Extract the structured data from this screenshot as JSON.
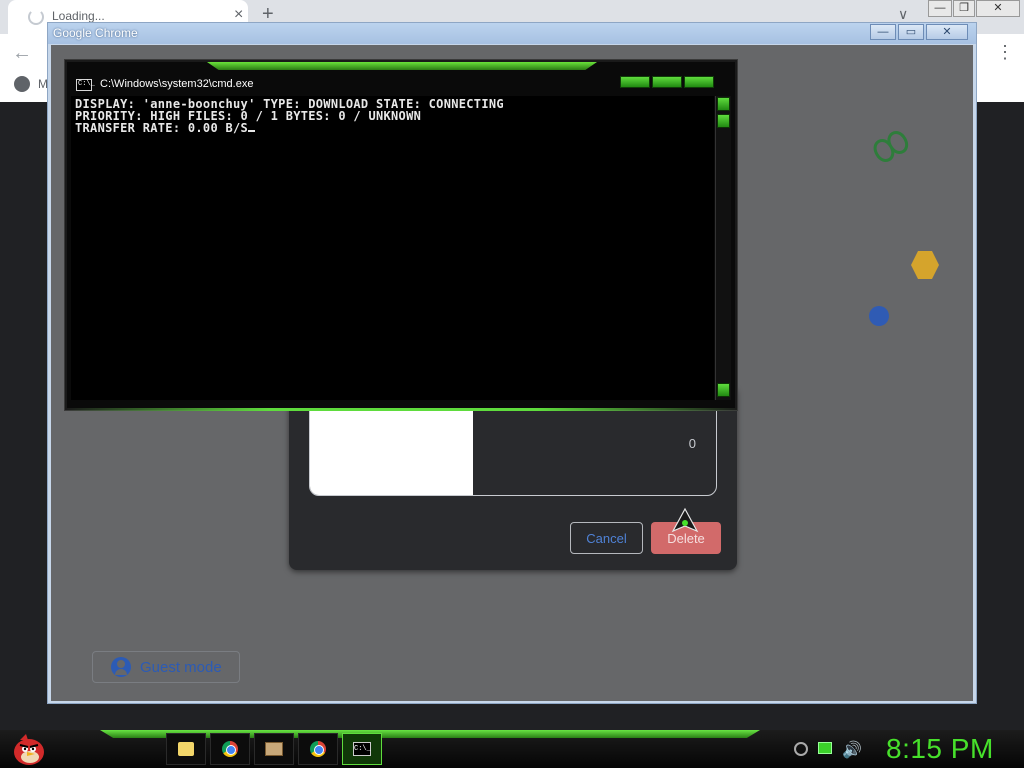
{
  "background_chrome": {
    "tab_title": "Loading...",
    "tab_close": "×",
    "new_tab": "+",
    "tabs_dropdown": "∨",
    "back": "←",
    "bookmark_text": "M",
    "menu": "⋮",
    "win_controls": [
      "—",
      "❐",
      "✕"
    ]
  },
  "window": {
    "title": "Google Chrome",
    "controls": [
      "—",
      "▭",
      "✕"
    ]
  },
  "dialog": {
    "count": "0",
    "cancel_label": "Cancel",
    "delete_label": "Delete"
  },
  "guest": {
    "label": "Guest mode"
  },
  "cmd": {
    "title": "C:\\Windows\\system32\\cmd.exe",
    "icon_text": "C:\\_",
    "lines": [
      "DISPLAY: 'anne-boonchuy' TYPE: DOWNLOAD STATE: CONNECTING",
      "PRIORITY: HIGH FILES: 0 / 1 BYTES: 0 / UNKNOWN",
      "TRANSFER RATE: 0.00 B/S"
    ]
  },
  "taskbar": {
    "clock": "8:15 PM",
    "items": [
      "folder",
      "chrome",
      "remote-desktop",
      "chrome",
      "cmd"
    ]
  },
  "colors": {
    "accent_green": "#47e02b",
    "delete_red": "#d26a6a",
    "link_blue": "#4f82d6"
  }
}
